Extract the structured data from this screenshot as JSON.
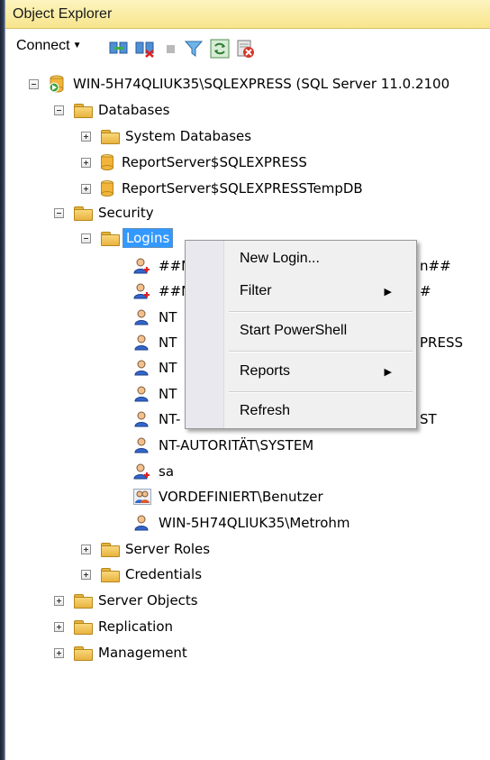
{
  "window": {
    "title": "Object Explorer"
  },
  "toolbar": {
    "connect_label": "Connect",
    "icons": [
      "connect-object-explorer-icon",
      "disconnect-icon",
      "stop-icon",
      "filter-icon",
      "refresh-icon",
      "activity-monitor-icon"
    ]
  },
  "tree": {
    "server": "WIN-5H74QLIUK35\\SQLEXPRESS (SQL Server 11.0.2100",
    "databases": "Databases",
    "system_databases": "System Databases",
    "db1": "ReportServer$SQLEXPRESS",
    "db2": "ReportServer$SQLEXPRESSTempDB",
    "security": "Security",
    "logins": "Logins",
    "login_items": [
      {
        "left": "##N",
        "right": "n##"
      },
      {
        "left": "##N",
        "right": "#"
      },
      {
        "left": "NT",
        "right": ""
      },
      {
        "left": "NT",
        "right": "PRESS"
      },
      {
        "left": "NT",
        "right": ""
      },
      {
        "left": "NT",
        "right": ""
      },
      {
        "left": "NT-",
        "right": "ST"
      }
    ],
    "nt_system": "NT-AUTORITÄT\\SYSTEM",
    "sa": "sa",
    "vordefiniert": "VORDEFINIERT\\Benutzer",
    "metrohm": "WIN-5H74QLIUK35\\Metrohm",
    "server_roles": "Server Roles",
    "credentials": "Credentials",
    "server_objects": "Server Objects",
    "replication": "Replication",
    "management": "Management"
  },
  "context_menu": {
    "new_login": "New Login...",
    "filter": "Filter",
    "start_powershell": "Start PowerShell",
    "reports": "Reports",
    "refresh": "Refresh"
  }
}
